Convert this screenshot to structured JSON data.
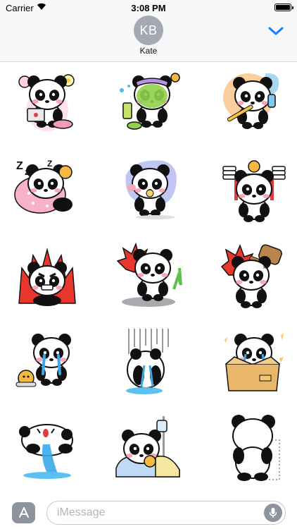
{
  "status_bar": {
    "carrier": "Carrier",
    "time": "3:08 PM",
    "battery_level": 1.0
  },
  "header": {
    "avatar_initials": "KB",
    "contact_name": "Kate",
    "collapse_icon": "chevron-down-icon"
  },
  "stickers": [
    {
      "name": "panda-laptop-flowers"
    },
    {
      "name": "panda-face-mask"
    },
    {
      "name": "panda-brushing-teeth"
    },
    {
      "name": "panda-sleeping-zzz"
    },
    {
      "name": "panda-eating"
    },
    {
      "name": "panda-lifting-weights"
    },
    {
      "name": "panda-angry-fire"
    },
    {
      "name": "panda-burst-lying"
    },
    {
      "name": "panda-hit-hammer"
    },
    {
      "name": "panda-crying-hamster"
    },
    {
      "name": "panda-gloomy-rain"
    },
    {
      "name": "panda-in-box"
    },
    {
      "name": "panda-crying-puddle"
    },
    {
      "name": "panda-sick-bed"
    },
    {
      "name": "panda-back-view"
    }
  ],
  "input_bar": {
    "placeholder": "iMessage",
    "app_icon": "app-store-icon",
    "mic_icon": "microphone-icon"
  },
  "colors": {
    "accent": "#147efb",
    "header_bg": "#f7f7f9",
    "avatar_bg": "#a4a9b3",
    "placeholder": "#b3b3b8"
  }
}
